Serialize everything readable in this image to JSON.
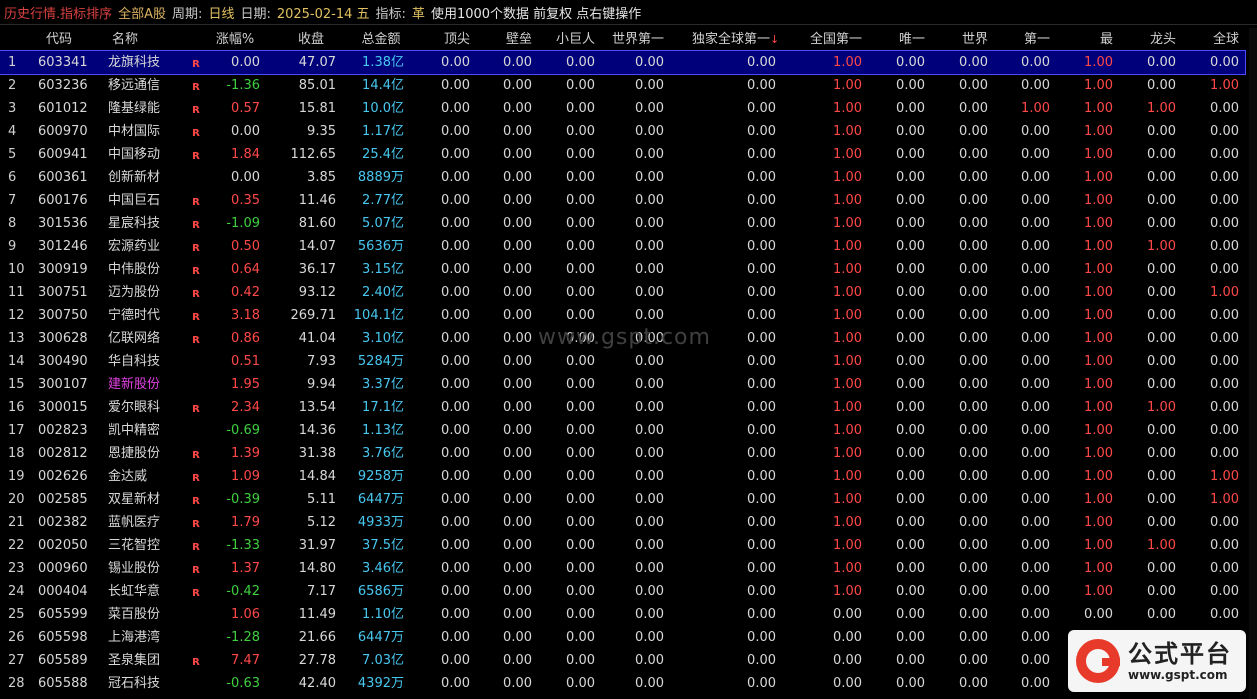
{
  "topbar": {
    "title": "历史行情.指标排序",
    "market": "全部A股",
    "period_label": "周期:",
    "period_value": "日线",
    "date_label": "日期:",
    "date_value": "2025-02-14 五",
    "indicator_label": "指标:",
    "indicator_value": "革",
    "info": "使用1000个数据 前复权 点右键操作"
  },
  "columns": [
    "",
    "代码",
    "名称",
    "涨幅%",
    "收盘",
    "总金额",
    "顶尖",
    "壁垒",
    "小巨人",
    "世界第一",
    "独家全球第一",
    "全国第一",
    "唯一",
    "世界",
    "第一",
    "最",
    "龙头",
    "全球"
  ],
  "sort_column_marker": "↓",
  "watermark": "www.gspt.com",
  "logo": {
    "cn": "公式平台",
    "url": "www.gspt.com"
  },
  "colors": {
    "up": "#ff4848",
    "down": "#3fcf3f",
    "amount": "#48c8f0",
    "selected_bg": "#00007a",
    "highlight_name": "#e040e0"
  },
  "rows": [
    {
      "idx": "1",
      "code": "603341",
      "name": "龙旗科技",
      "r": "R",
      "chg": "0.00",
      "dir": "flat",
      "close": "47.07",
      "amt": "1.38亿",
      "v": [
        "0.00",
        "0.00",
        "0.00",
        "0.00",
        "0.00",
        "1.00",
        "0.00",
        "0.00",
        "0.00",
        "1.00",
        "0.00",
        "0.00",
        "1.00"
      ]
    },
    {
      "idx": "2",
      "code": "603236",
      "name": "移远通信",
      "r": "R",
      "chg": "-1.36",
      "dir": "down",
      "close": "85.01",
      "amt": "14.4亿",
      "v": [
        "0.00",
        "0.00",
        "0.00",
        "0.00",
        "0.00",
        "1.00",
        "0.00",
        "0.00",
        "0.00",
        "1.00",
        "0.00",
        "1.00",
        "1.00"
      ]
    },
    {
      "idx": "3",
      "code": "601012",
      "name": "隆基绿能",
      "r": "R",
      "chg": "0.57",
      "dir": "up",
      "close": "15.81",
      "amt": "10.0亿",
      "v": [
        "0.00",
        "0.00",
        "0.00",
        "0.00",
        "0.00",
        "1.00",
        "0.00",
        "0.00",
        "1.00",
        "1.00",
        "1.00",
        "0.00",
        "1.00"
      ]
    },
    {
      "idx": "4",
      "code": "600970",
      "name": "中材国际",
      "r": "R",
      "chg": "0.00",
      "dir": "flat",
      "close": "9.35",
      "amt": "1.17亿",
      "v": [
        "0.00",
        "0.00",
        "0.00",
        "0.00",
        "0.00",
        "1.00",
        "0.00",
        "0.00",
        "0.00",
        "1.00",
        "0.00",
        "0.00",
        "1.00"
      ]
    },
    {
      "idx": "5",
      "code": "600941",
      "name": "中国移动",
      "r": "R",
      "chg": "1.84",
      "dir": "up",
      "close": "112.65",
      "amt": "25.4亿",
      "v": [
        "0.00",
        "0.00",
        "0.00",
        "0.00",
        "0.00",
        "1.00",
        "0.00",
        "0.00",
        "0.00",
        "1.00",
        "0.00",
        "0.00",
        "1.00"
      ]
    },
    {
      "idx": "6",
      "code": "600361",
      "name": "创新新材",
      "r": "",
      "chg": "0.00",
      "dir": "flat",
      "close": "3.85",
      "amt": "8889万",
      "v": [
        "0.00",
        "0.00",
        "0.00",
        "0.00",
        "0.00",
        "1.00",
        "0.00",
        "0.00",
        "0.00",
        "1.00",
        "0.00",
        "0.00",
        "1.00"
      ]
    },
    {
      "idx": "7",
      "code": "600176",
      "name": "中国巨石",
      "r": "R",
      "chg": "0.35",
      "dir": "up",
      "close": "11.46",
      "amt": "2.77亿",
      "v": [
        "0.00",
        "0.00",
        "0.00",
        "0.00",
        "0.00",
        "1.00",
        "0.00",
        "0.00",
        "0.00",
        "1.00",
        "0.00",
        "0.00",
        "1.00"
      ]
    },
    {
      "idx": "8",
      "code": "301536",
      "name": "星宸科技",
      "r": "R",
      "chg": "-1.09",
      "dir": "down",
      "close": "81.60",
      "amt": "5.07亿",
      "v": [
        "0.00",
        "0.00",
        "0.00",
        "0.00",
        "0.00",
        "1.00",
        "0.00",
        "0.00",
        "0.00",
        "1.00",
        "0.00",
        "0.00",
        "1.00"
      ]
    },
    {
      "idx": "9",
      "code": "301246",
      "name": "宏源药业",
      "r": "R",
      "chg": "0.50",
      "dir": "up",
      "close": "14.07",
      "amt": "5636万",
      "v": [
        "0.00",
        "0.00",
        "0.00",
        "0.00",
        "0.00",
        "1.00",
        "0.00",
        "0.00",
        "0.00",
        "1.00",
        "1.00",
        "0.00",
        "1.00"
      ]
    },
    {
      "idx": "10",
      "code": "300919",
      "name": "中伟股份",
      "r": "R",
      "chg": "0.64",
      "dir": "up",
      "close": "36.17",
      "amt": "3.15亿",
      "v": [
        "0.00",
        "0.00",
        "0.00",
        "0.00",
        "0.00",
        "1.00",
        "0.00",
        "0.00",
        "0.00",
        "1.00",
        "0.00",
        "0.00",
        "1.00"
      ]
    },
    {
      "idx": "11",
      "code": "300751",
      "name": "迈为股份",
      "r": "R",
      "chg": "0.42",
      "dir": "up",
      "close": "93.12",
      "amt": "2.40亿",
      "v": [
        "0.00",
        "0.00",
        "0.00",
        "0.00",
        "0.00",
        "1.00",
        "0.00",
        "0.00",
        "0.00",
        "1.00",
        "0.00",
        "1.00",
        "1.00"
      ]
    },
    {
      "idx": "12",
      "code": "300750",
      "name": "宁德时代",
      "r": "R",
      "chg": "3.18",
      "dir": "up",
      "close": "269.71",
      "amt": "104.1亿",
      "v": [
        "0.00",
        "0.00",
        "0.00",
        "0.00",
        "0.00",
        "1.00",
        "0.00",
        "0.00",
        "0.00",
        "1.00",
        "0.00",
        "0.00",
        "1.00"
      ]
    },
    {
      "idx": "13",
      "code": "300628",
      "name": "亿联网络",
      "r": "R",
      "chg": "0.86",
      "dir": "up",
      "close": "41.04",
      "amt": "3.10亿",
      "v": [
        "0.00",
        "0.00",
        "0.00",
        "0.00",
        "0.00",
        "1.00",
        "0.00",
        "0.00",
        "0.00",
        "1.00",
        "0.00",
        "0.00",
        "1.00"
      ]
    },
    {
      "idx": "14",
      "code": "300490",
      "name": "华自科技",
      "r": "",
      "chg": "0.51",
      "dir": "up",
      "close": "7.93",
      "amt": "5284万",
      "v": [
        "0.00",
        "0.00",
        "0.00",
        "0.00",
        "0.00",
        "1.00",
        "0.00",
        "0.00",
        "0.00",
        "1.00",
        "0.00",
        "0.00",
        "1.00"
      ]
    },
    {
      "idx": "15",
      "code": "300107",
      "name": "建新股份",
      "r": "",
      "chg": "1.95",
      "dir": "up",
      "close": "9.94",
      "amt": "3.37亿",
      "pink": true,
      "v": [
        "0.00",
        "0.00",
        "0.00",
        "0.00",
        "0.00",
        "1.00",
        "0.00",
        "0.00",
        "0.00",
        "1.00",
        "0.00",
        "0.00",
        "1.00"
      ]
    },
    {
      "idx": "16",
      "code": "300015",
      "name": "爱尔眼科",
      "r": "R",
      "chg": "2.34",
      "dir": "up",
      "close": "13.54",
      "amt": "17.1亿",
      "v": [
        "0.00",
        "0.00",
        "0.00",
        "0.00",
        "0.00",
        "1.00",
        "0.00",
        "0.00",
        "0.00",
        "1.00",
        "1.00",
        "0.00",
        "1.00"
      ]
    },
    {
      "idx": "17",
      "code": "002823",
      "name": "凯中精密",
      "r": "",
      "chg": "-0.69",
      "dir": "down",
      "close": "14.36",
      "amt": "1.13亿",
      "v": [
        "0.00",
        "0.00",
        "0.00",
        "0.00",
        "0.00",
        "1.00",
        "0.00",
        "0.00",
        "0.00",
        "1.00",
        "0.00",
        "0.00",
        "1.00"
      ]
    },
    {
      "idx": "18",
      "code": "002812",
      "name": "恩捷股份",
      "r": "R",
      "chg": "1.39",
      "dir": "up",
      "close": "31.38",
      "amt": "3.76亿",
      "v": [
        "0.00",
        "0.00",
        "0.00",
        "0.00",
        "0.00",
        "1.00",
        "0.00",
        "0.00",
        "0.00",
        "1.00",
        "0.00",
        "0.00",
        "1.00"
      ]
    },
    {
      "idx": "19",
      "code": "002626",
      "name": "金达威",
      "r": "R",
      "chg": "1.09",
      "dir": "up",
      "close": "14.84",
      "amt": "9258万",
      "v": [
        "0.00",
        "0.00",
        "0.00",
        "0.00",
        "0.00",
        "1.00",
        "0.00",
        "0.00",
        "0.00",
        "1.00",
        "0.00",
        "1.00",
        "1.00"
      ]
    },
    {
      "idx": "20",
      "code": "002585",
      "name": "双星新材",
      "r": "R",
      "chg": "-0.39",
      "dir": "down",
      "close": "5.11",
      "amt": "6447万",
      "v": [
        "0.00",
        "0.00",
        "0.00",
        "0.00",
        "0.00",
        "1.00",
        "0.00",
        "0.00",
        "0.00",
        "1.00",
        "0.00",
        "1.00",
        "1.00"
      ]
    },
    {
      "idx": "21",
      "code": "002382",
      "name": "蓝帆医疗",
      "r": "R",
      "chg": "1.79",
      "dir": "up",
      "close": "5.12",
      "amt": "4933万",
      "v": [
        "0.00",
        "0.00",
        "0.00",
        "0.00",
        "0.00",
        "1.00",
        "0.00",
        "0.00",
        "0.00",
        "1.00",
        "0.00",
        "0.00",
        "1.00"
      ]
    },
    {
      "idx": "22",
      "code": "002050",
      "name": "三花智控",
      "r": "R",
      "chg": "-1.33",
      "dir": "down",
      "close": "31.97",
      "amt": "37.5亿",
      "v": [
        "0.00",
        "0.00",
        "0.00",
        "0.00",
        "0.00",
        "1.00",
        "0.00",
        "0.00",
        "0.00",
        "1.00",
        "1.00",
        "0.00",
        "1.00"
      ]
    },
    {
      "idx": "23",
      "code": "000960",
      "name": "锡业股份",
      "r": "R",
      "chg": "1.37",
      "dir": "up",
      "close": "14.80",
      "amt": "3.46亿",
      "v": [
        "0.00",
        "0.00",
        "0.00",
        "0.00",
        "0.00",
        "1.00",
        "0.00",
        "0.00",
        "0.00",
        "1.00",
        "0.00",
        "0.00",
        "1.00"
      ]
    },
    {
      "idx": "24",
      "code": "000404",
      "name": "长虹华意",
      "r": "R",
      "chg": "-0.42",
      "dir": "down",
      "close": "7.17",
      "amt": "6586万",
      "v": [
        "0.00",
        "0.00",
        "0.00",
        "0.00",
        "0.00",
        "1.00",
        "0.00",
        "0.00",
        "0.00",
        "1.00",
        "0.00",
        "0.00",
        "1.00"
      ]
    },
    {
      "idx": "25",
      "code": "605599",
      "name": "菜百股份",
      "r": "",
      "chg": "1.06",
      "dir": "up",
      "close": "11.49",
      "amt": "1.10亿",
      "v": [
        "0.00",
        "0.00",
        "0.00",
        "0.00",
        "0.00",
        "0.00",
        "0.00",
        "0.00",
        "0.00",
        "0.00",
        "0.00",
        "0.00",
        "0.00"
      ]
    },
    {
      "idx": "26",
      "code": "605598",
      "name": "上海港湾",
      "r": "",
      "chg": "-1.28",
      "dir": "down",
      "close": "21.66",
      "amt": "6447万",
      "v": [
        "0.00",
        "0.00",
        "0.00",
        "0.00",
        "0.00",
        "0.00",
        "0.00",
        "0.00",
        "0.00",
        "0.00",
        "0.00",
        "0.00",
        "0.00"
      ]
    },
    {
      "idx": "27",
      "code": "605589",
      "name": "圣泉集团",
      "r": "R",
      "chg": "7.47",
      "dir": "up",
      "close": "27.78",
      "amt": "7.03亿",
      "v": [
        "0.00",
        "0.00",
        "0.00",
        "0.00",
        "0.00",
        "0.00",
        "0.00",
        "0.00",
        "0.00",
        "1.00",
        "0.00",
        "0.00",
        "0.00"
      ]
    },
    {
      "idx": "28",
      "code": "605588",
      "name": "冠石科技",
      "r": "",
      "chg": "-0.63",
      "dir": "down",
      "close": "42.40",
      "amt": "4392万",
      "v": [
        "0.00",
        "0.00",
        "0.00",
        "0.00",
        "0.00",
        "0.00",
        "0.00",
        "0.00",
        "0.00",
        "0.00",
        "0.00",
        "0.00",
        "0.00"
      ]
    }
  ]
}
